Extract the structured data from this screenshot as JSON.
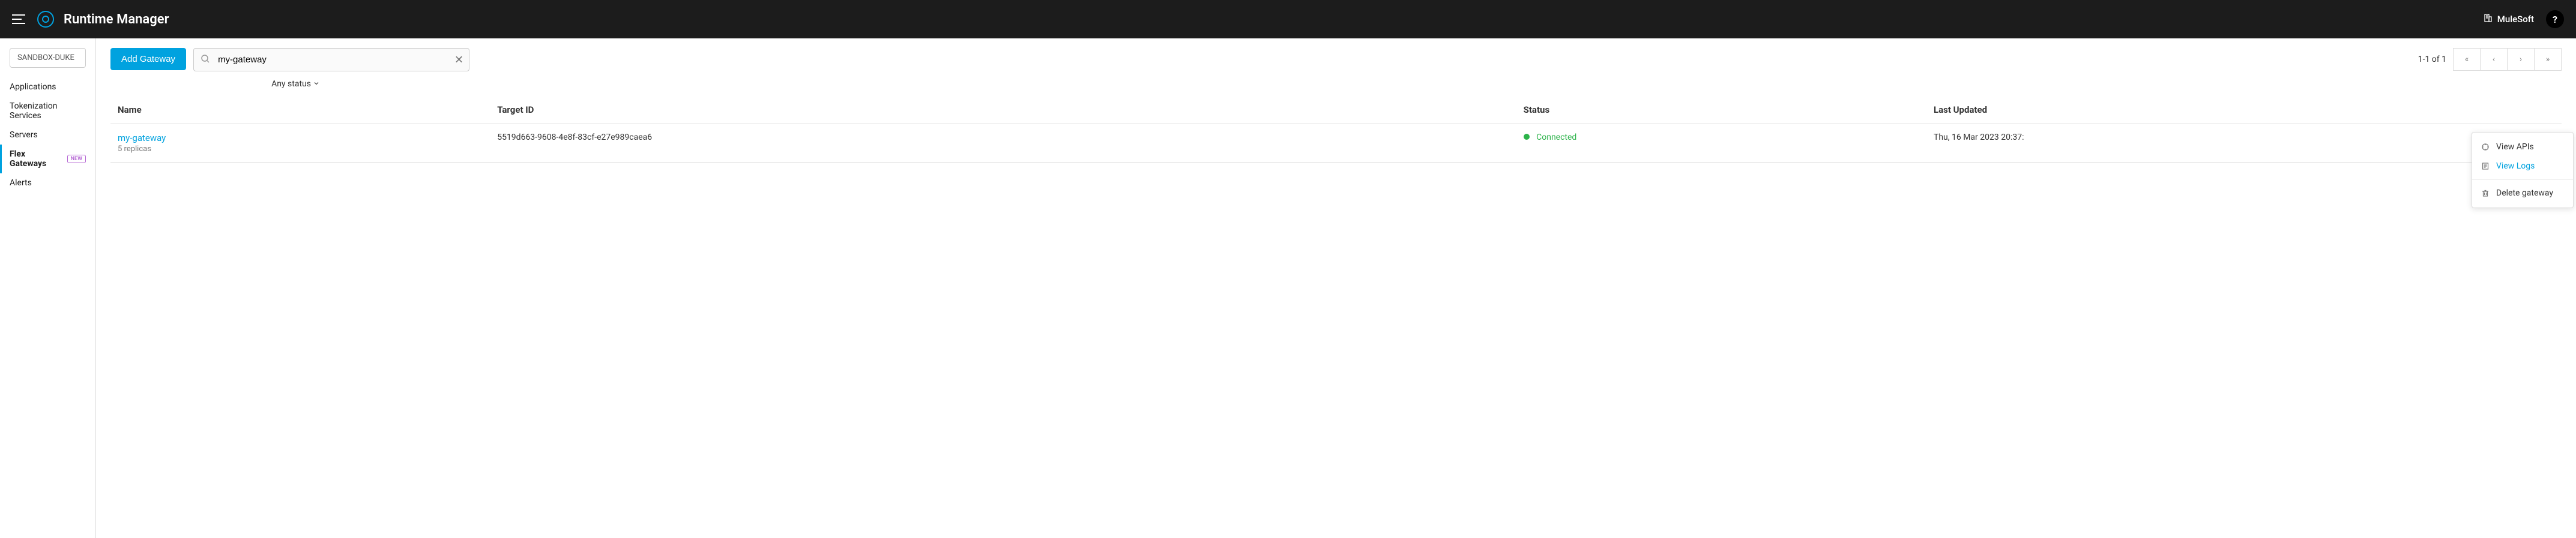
{
  "header": {
    "app_title": "Runtime Manager",
    "org_name": "MuleSoft",
    "help_label": "?"
  },
  "sidebar": {
    "environment": "SANDBOX-DUKE",
    "items": [
      {
        "label": "Applications"
      },
      {
        "label": "Tokenization Services"
      },
      {
        "label": "Servers"
      },
      {
        "label": "Flex Gateways",
        "badge": "NEW"
      },
      {
        "label": "Alerts"
      }
    ]
  },
  "toolbar": {
    "add_button": "Add Gateway",
    "search_value": "my-gateway",
    "search_placeholder": "",
    "status_filter": "Any status"
  },
  "pagination": {
    "range": "1-1 of 1",
    "first": "«",
    "prev": "‹",
    "next": "›",
    "last": "»"
  },
  "table": {
    "columns": {
      "name": "Name",
      "target_id": "Target ID",
      "status": "Status",
      "last_updated": "Last Updated"
    },
    "rows": [
      {
        "name": "my-gateway",
        "replicas": "5 replicas",
        "target_id": "5519d663-9608-4e8f-83cf-e27e989caea6",
        "status": "Connected",
        "last_updated": "Thu, 16 Mar 2023 20:37:"
      }
    ]
  },
  "action_menu": {
    "view_apis": "View APIs",
    "view_logs": "View Logs",
    "delete_gateway": "Delete gateway"
  }
}
